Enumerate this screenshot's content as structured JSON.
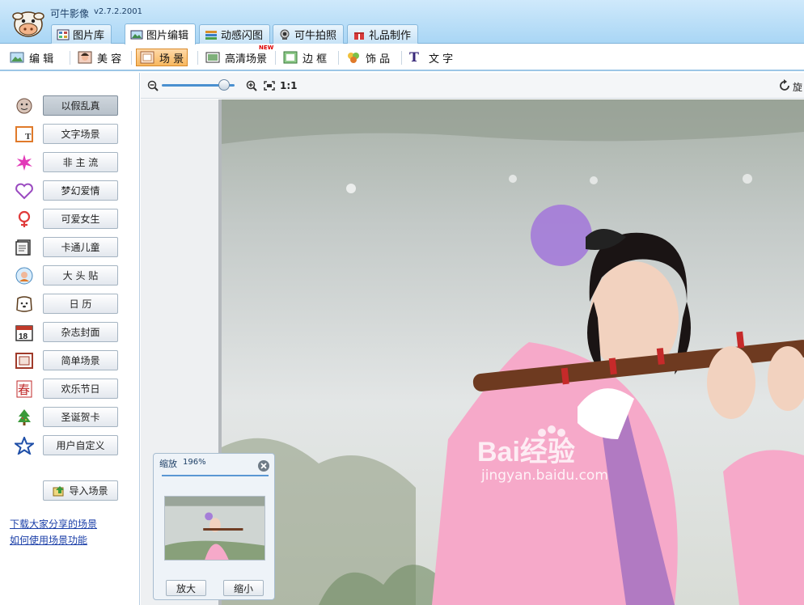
{
  "app": {
    "title": "可牛影像",
    "version": "v2.7.2.2001"
  },
  "tabs": [
    {
      "label": "图片库",
      "icon": "gallery-icon"
    },
    {
      "label": "图片编辑",
      "icon": "edit-image-icon",
      "active": true
    },
    {
      "label": "动感闪图",
      "icon": "flash-image-icon"
    },
    {
      "label": "可牛拍照",
      "icon": "webcam-icon"
    },
    {
      "label": "礼品制作",
      "icon": "gift-icon"
    }
  ],
  "tools": [
    {
      "label": "编 辑",
      "icon": "edit-icon"
    },
    {
      "label": "美 容",
      "icon": "beauty-icon"
    },
    {
      "label": "场 景",
      "icon": "scene-icon",
      "active": true
    },
    {
      "label": "高清场景",
      "icon": "hd-scene-icon",
      "badge": "NEW"
    },
    {
      "label": "边 框",
      "icon": "frame-icon"
    },
    {
      "label": "饰 品",
      "icon": "decoration-icon"
    },
    {
      "label": "文 字",
      "icon": "text-icon"
    }
  ],
  "scenes": [
    {
      "label": "以假乱真",
      "icon": "face-icon",
      "active": true
    },
    {
      "label": "文字场景",
      "icon": "text-scene-icon"
    },
    {
      "label": "非 主 流",
      "icon": "sparkle-icon"
    },
    {
      "label": "梦幻爱情",
      "icon": "heart-icon"
    },
    {
      "label": "可爱女生",
      "icon": "female-icon"
    },
    {
      "label": "卡通儿童",
      "icon": "cartoon-book-icon"
    },
    {
      "label": "大 头 贴",
      "icon": "sticker-icon"
    },
    {
      "label": "日  历",
      "icon": "calendar-dog-icon"
    },
    {
      "label": "杂志封面",
      "icon": "calendar-icon"
    },
    {
      "label": "简单场景",
      "icon": "simple-frame-icon"
    },
    {
      "label": "欢乐节日",
      "icon": "festival-icon"
    },
    {
      "label": "圣诞贺卡",
      "icon": "christmas-tree-icon"
    },
    {
      "label": "用户自定义",
      "icon": "star-icon"
    }
  ],
  "calendar_icon_day": "18",
  "festival_icon_char": "春",
  "import_button": {
    "label": "导入场景",
    "icon": "import-icon"
  },
  "links": {
    "download_shared": "下载大家分享的场景",
    "how_to_use": "如何使用场景功能"
  },
  "canvas_toolbar": {
    "actual_size": "1:1",
    "rotate_label": "旋",
    "zoom_level": 0.85
  },
  "navigator": {
    "title": "缩放",
    "percent": "196%",
    "zoom_in_label": "放大",
    "zoom_out_label": "缩小"
  },
  "watermark": {
    "brand": "Bai经验",
    "url": "jingyan.baidu.com"
  },
  "colors": {
    "accent": "#4a90d0",
    "active_tool": "#f7b75e",
    "link": "#1b3fa8"
  }
}
